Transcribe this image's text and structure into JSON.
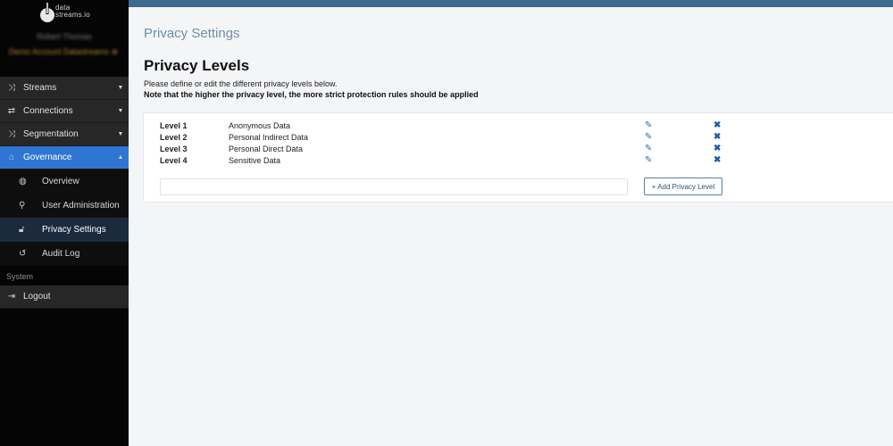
{
  "brand": {
    "logo_line1": "data",
    "logo_line2": "streams.io",
    "user_name": "Robert Thomas",
    "account": "Demo Account Datastreams"
  },
  "sidebar": {
    "items": [
      {
        "label": "Streams",
        "icon": "shuffle-icon"
      },
      {
        "label": "Connections",
        "icon": "connections-icon"
      },
      {
        "label": "Segmentation",
        "icon": "shuffle-icon"
      },
      {
        "label": "Governance",
        "icon": "bank-icon"
      }
    ],
    "governance_sub": [
      {
        "label": "Overview",
        "icon": "globe-icon"
      },
      {
        "label": "User Administration",
        "icon": "user-plus-icon"
      },
      {
        "label": "Privacy Settings",
        "icon": "lock-icon"
      },
      {
        "label": "Audit Log",
        "icon": "history-icon"
      }
    ],
    "section_label": "System",
    "logout_label": "Logout"
  },
  "main": {
    "page_title": "Privacy Settings",
    "heading": "Privacy Levels",
    "description": "Please define or edit the different privacy levels below.",
    "note": "Note that the higher the privacy level, the more strict protection rules should be applied",
    "levels": [
      {
        "level": "Level 1",
        "name": "Anonymous Data"
      },
      {
        "level": "Level 2",
        "name": "Personal Indirect Data"
      },
      {
        "level": "Level 3",
        "name": "Personal Direct Data"
      },
      {
        "level": "Level 4",
        "name": "Sensitive Data"
      }
    ],
    "new_level_value": "",
    "add_button": "+ Add Privacy Level"
  },
  "colors": {
    "sidebar_bg": "#050505",
    "active_nav": "#2f76d2",
    "topbar": "#3d6c8d",
    "action_icon": "#2f6ea8"
  }
}
